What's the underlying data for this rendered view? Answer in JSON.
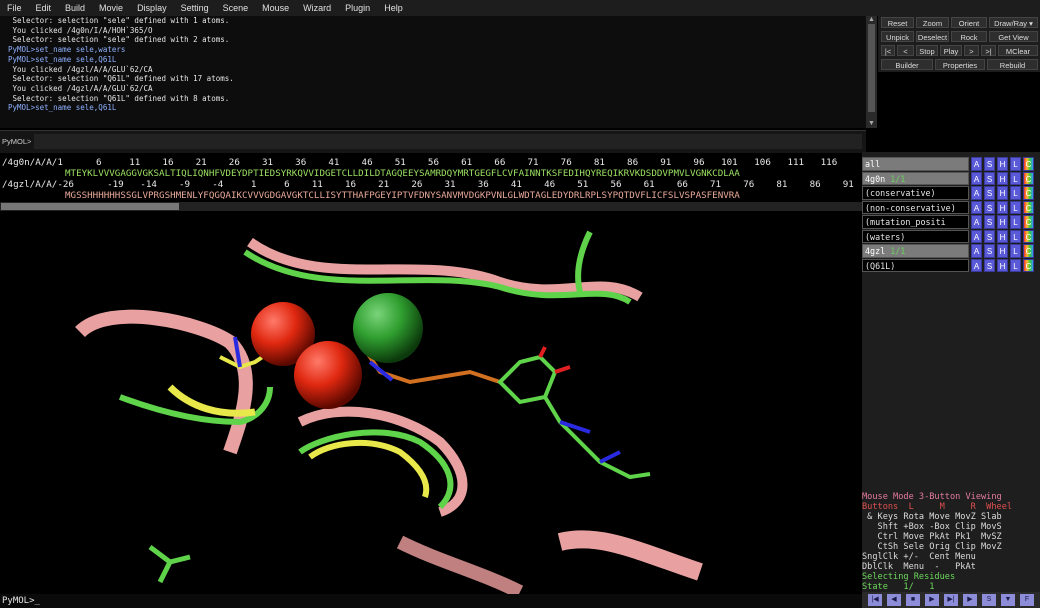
{
  "menu": [
    "File",
    "Edit",
    "Build",
    "Movie",
    "Display",
    "Setting",
    "Scene",
    "Mouse",
    "Wizard",
    "Plugin",
    "Help"
  ],
  "console_lines": [
    {
      "text": " Selector: selection \"sele\" defined with 1 atoms.",
      "kind": "out"
    },
    {
      "text": " You clicked /4g0n/I/A/HOH`365/O",
      "kind": "out"
    },
    {
      "text": " Selector: selection \"sele\" defined with 2 atoms.",
      "kind": "out"
    },
    {
      "text": "PyMOL>set_name sele,waters",
      "kind": "cmd"
    },
    {
      "text": "PyMOL>set_name sele,Q61L",
      "kind": "cmd"
    },
    {
      "text": " You clicked /4gzl/A/A/GLU`62/CA",
      "kind": "out"
    },
    {
      "text": " Selector: selection \"Q61L\" defined with 17 atoms.",
      "kind": "out"
    },
    {
      "text": " You clicked /4gzl/A/A/GLU`62/CA",
      "kind": "out"
    },
    {
      "text": " Selector: selection \"Q61L\" defined with 8 atoms.",
      "kind": "out"
    },
    {
      "text": "PyMOL>set_name sele,Q61L",
      "kind": "cmd"
    }
  ],
  "buttons": [
    "Reset",
    "Zoom",
    "Orient",
    "Draw/Ray",
    "Unpick",
    "Deselect",
    "Rock",
    "Get View",
    "|<",
    "<",
    "Stop",
    "Play",
    ">",
    ">|",
    "MClear",
    "Builder",
    "Properties",
    "Rebuild"
  ],
  "prompt_label": "PyMOL>",
  "sequence": {
    "row1_label": "/4g0n/A/A/1      6     11    16    21    26    31    36    41    46    51    56    61    66    71    76    81    86    91    96   101   106   111   116",
    "row1_seq": "MTEYKLVVVGAGGVGKSALTIQLIQNHFVDEYDPTIEDSYRKQVVIDGETCLLDILDTAGQEEYSAMRDQYMRTGEGFLCVFAINNTKSFEDIHQYREQIKRVKDSDDVPMVLVGNKCDLAA",
    "row2_label": "/4gzl/A/A/-26      -19   -14    -9    -4     1     6    11    16    21    26    31    36    41    46    51    56    61    66    71    76    81    86    91",
    "row2_seq": "MGSSHHHHHHSSGLVPRGSHMENLYFQGQAIKCVVVGDGAVGKTCLLISYTTHAFPGEYIPTVFDNYSANVMVDGKPVNLGLWDTAGLEDYDRLRPLSYPQTDVFLICFSLVSPASFENVRA"
  },
  "objects": [
    {
      "name": "all",
      "frame": "",
      "selected": true
    },
    {
      "name": "4g0n",
      "frame": "1/1",
      "selected": true
    },
    {
      "name": "(conservative)",
      "frame": "",
      "selected": false
    },
    {
      "name": "(non-conservative)",
      "frame": "",
      "selected": false
    },
    {
      "name": "(mutation_positi",
      "frame": "",
      "selected": false
    },
    {
      "name": "(waters)",
      "frame": "",
      "selected": false
    },
    {
      "name": "4gzl",
      "frame": "1/1",
      "selected": true
    },
    {
      "name": "(Q61L)",
      "frame": "",
      "selected": false
    }
  ],
  "object_buttons": [
    "A",
    "S",
    "H",
    "L",
    "C"
  ],
  "mouse_info": [
    {
      "text": "Mouse Mode 3-Button Viewing",
      "cls": "c-mode"
    },
    {
      "text": "Buttons  L     M     R  Wheel",
      "cls": "c-but"
    },
    {
      "text": " & Keys Rota Move MovZ Slab",
      "cls": ""
    },
    {
      "text": "   Shft +Box -Box Clip MovS",
      "cls": ""
    },
    {
      "text": "   Ctrl Move PkAt Pk1  MvSZ",
      "cls": ""
    },
    {
      "text": "   CtSh Sele Orig Clip MovZ",
      "cls": ""
    },
    {
      "text": "SnglClk +/-  Cent Menu",
      "cls": ""
    },
    {
      "text": "DblClk  Menu  -   PkAt",
      "cls": ""
    },
    {
      "text": "Selecting Residues",
      "cls": "c-grn"
    },
    {
      "text": "State   1/   1",
      "cls": "c-grn"
    }
  ],
  "movie_controls": [
    "|◀",
    "◀",
    "■",
    "▶",
    "▶|",
    "▶",
    "S",
    "▼",
    "F"
  ],
  "cmdline": "PyMOL>_",
  "colors": {
    "green": "#5fd34a",
    "pink": "#e8a0a0",
    "yellow": "#e8e84a",
    "red": "#e82020",
    "oxygen_ball": "#e02810",
    "chloride_ball": "#2f9e2f",
    "blue": "#2a2ae0",
    "orange": "#d07020"
  }
}
